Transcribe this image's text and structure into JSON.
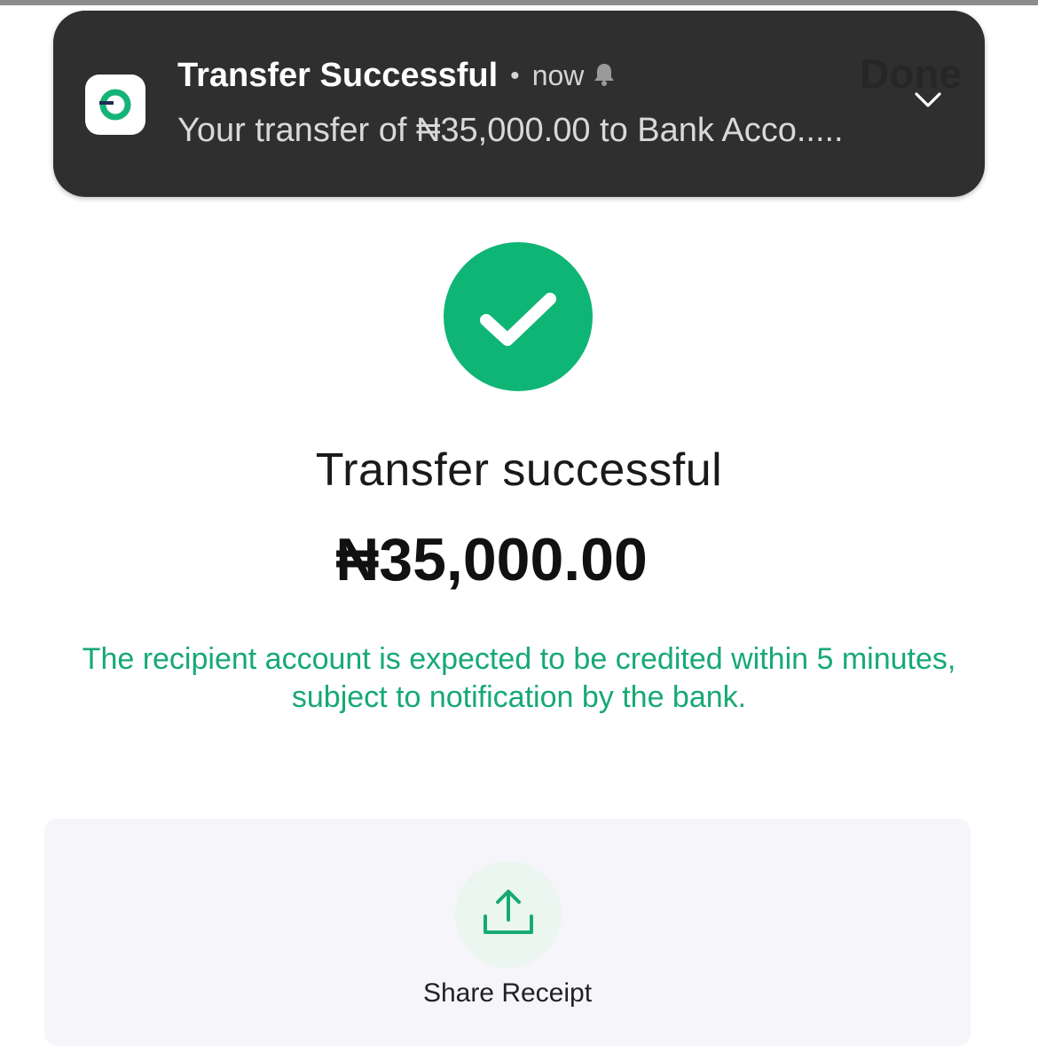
{
  "notification": {
    "title": "Transfer Successful",
    "separator": "•",
    "time": "now",
    "body": "Your transfer of ₦35,000.00 to Bank Acco.....",
    "overlay_text": "Done",
    "icons": {
      "app": "app-logo-icon",
      "bell": "bell-icon",
      "expand": "chevron-down-icon"
    }
  },
  "status": {
    "icon": "check-icon",
    "title": "Transfer successful",
    "amount": "₦35,000.00",
    "info": "The recipient account is expected to be credited within 5 minutes, subject to notification by the bank."
  },
  "actions": {
    "share_label": "Share Receipt",
    "share_icon": "share-upload-icon"
  },
  "colors": {
    "accent_green": "#0fb574",
    "info_text_green": "#16a974",
    "banner_bg": "#2f2f2f",
    "card_bg": "#f5f5fa"
  }
}
